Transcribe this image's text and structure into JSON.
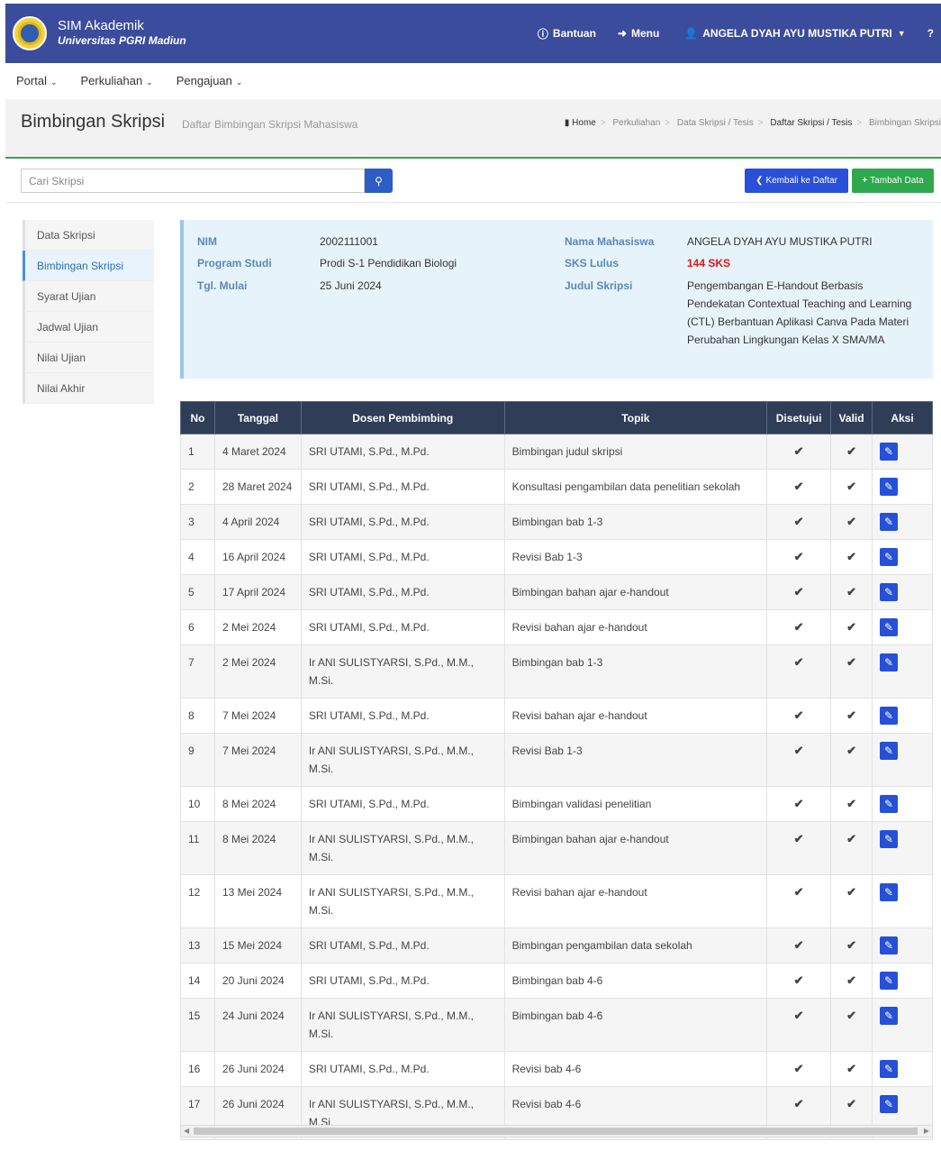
{
  "app": {
    "name": "SIM Akademik",
    "university": "Universitas PGRI Madiun"
  },
  "topnav": {
    "help": "Bantuan",
    "menu": "Menu",
    "user": "ANGELA DYAH AYU MUSTIKA PUTRI",
    "question_icon": "?"
  },
  "menubar": [
    "Portal",
    "Perkuliahan",
    "Pengajuan"
  ],
  "page": {
    "title": "Bimbingan Skripsi",
    "subtitle": "Daftar Bimbingan Skripsi Mahasiswa"
  },
  "breadcrumb": [
    "Home",
    "Perkuliahan",
    "Data Skripsi / Tesis",
    "Daftar Skripsi / Tesis",
    "Bimbingan Skripsi"
  ],
  "toolbar": {
    "search_placeholder": "Cari Skripsi",
    "back_label": "Kembali ke Daftar",
    "add_label": "Tambah Data"
  },
  "sidenav": [
    "Data Skripsi",
    "Bimbingan Skripsi",
    "Syarat Ujian",
    "Jadwal Ujian",
    "Nilai Ujian",
    "Nilai Akhir"
  ],
  "info": {
    "nim_label": "NIM",
    "nim": "2002111001",
    "prodi_label": "Program Studi",
    "prodi": "Prodi S-1 Pendidikan Biologi",
    "mulai_label": "Tgl. Mulai",
    "mulai": "25 Juni 2024",
    "nama_label": "Nama Mahasiswa",
    "nama": "ANGELA DYAH AYU MUSTIKA PUTRI",
    "sks_label": "SKS Lulus",
    "sks": "144 SKS",
    "judul_label": "Judul Skripsi",
    "judul": "Pengembangan E-Handout Berbasis Pendekatan Contextual Teaching and Learning (CTL) Berbantuan Aplikasi Canva Pada Materi Perubahan Lingkungan Kelas X SMA/MA"
  },
  "table": {
    "headers": [
      "No",
      "Tanggal",
      "Dosen Pembimbing",
      "Topik",
      "Disetujui",
      "Valid",
      "Aksi"
    ],
    "rows": [
      {
        "no": "1",
        "tanggal": "4 Maret 2024",
        "dosen": "SRI UTAMI, S.Pd., M.Pd.",
        "topik": "Bimbingan judul skripsi"
      },
      {
        "no": "2",
        "tanggal": "28 Maret 2024",
        "dosen": "SRI UTAMI, S.Pd., M.Pd.",
        "topik": "Konsultasi pengambilan data penelitian sekolah"
      },
      {
        "no": "3",
        "tanggal": "4 April 2024",
        "dosen": "SRI UTAMI, S.Pd., M.Pd.",
        "topik": "Bimbingan bab 1-3"
      },
      {
        "no": "4",
        "tanggal": "16 April 2024",
        "dosen": "SRI UTAMI, S.Pd., M.Pd.",
        "topik": "Revisi Bab 1-3"
      },
      {
        "no": "5",
        "tanggal": "17 April 2024",
        "dosen": "SRI UTAMI, S.Pd., M.Pd.",
        "topik": "Bimbingan bahan ajar e-handout"
      },
      {
        "no": "6",
        "tanggal": "2 Mei 2024",
        "dosen": "SRI UTAMI, S.Pd., M.Pd.",
        "topik": "Revisi bahan ajar e-handout"
      },
      {
        "no": "7",
        "tanggal": "2 Mei 2024",
        "dosen": "Ir ANI SULISTYARSI, S.Pd., M.M., M.Si.",
        "topik": "Bimbingan bab 1-3"
      },
      {
        "no": "8",
        "tanggal": "7 Mei 2024",
        "dosen": "SRI UTAMI, S.Pd., M.Pd.",
        "topik": "Revisi bahan ajar e-handout"
      },
      {
        "no": "9",
        "tanggal": "7 Mei 2024",
        "dosen": "Ir ANI SULISTYARSI, S.Pd., M.M., M.Si.",
        "topik": "Revisi Bab 1-3"
      },
      {
        "no": "10",
        "tanggal": "8 Mei 2024",
        "dosen": "SRI UTAMI, S.Pd., M.Pd.",
        "topik": "Bimbingan validasi penelitian"
      },
      {
        "no": "11",
        "tanggal": "8 Mei 2024",
        "dosen": "Ir ANI SULISTYARSI, S.Pd., M.M., M.Si.",
        "topik": "Bimbingan bahan ajar e-handout"
      },
      {
        "no": "12",
        "tanggal": "13 Mei 2024",
        "dosen": "Ir ANI SULISTYARSI, S.Pd., M.M., M.Si.",
        "topik": "Revisi bahan ajar e-handout"
      },
      {
        "no": "13",
        "tanggal": "15 Mei 2024",
        "dosen": "SRI UTAMI, S.Pd., M.Pd.",
        "topik": "Bimbingan pengambilan data sekolah"
      },
      {
        "no": "14",
        "tanggal": "20 Juni 2024",
        "dosen": "SRI UTAMI, S.Pd., M.Pd.",
        "topik": "Bimbingan bab 4-6"
      },
      {
        "no": "15",
        "tanggal": "24 Juni 2024",
        "dosen": "Ir ANI SULISTYARSI, S.Pd., M.M., M.Si.",
        "topik": "Bimbingan bab 4-6"
      },
      {
        "no": "16",
        "tanggal": "26 Juni 2024",
        "dosen": "SRI UTAMI, S.Pd., M.Pd.",
        "topik": "Revisi bab 4-6"
      },
      {
        "no": "17",
        "tanggal": "26 Juni 2024",
        "dosen": "Ir ANI SULISTYARSI, S.Pd., M.M., M.Si.",
        "topik": "Revisi bab 4-6"
      }
    ]
  },
  "colors": {
    "topbar": "#3a4c9b",
    "table_header": "#2f3e56",
    "check": "#2aa149",
    "edit": "#2650d8",
    "add_button": "#2ea84d",
    "back_button": "#2a4fd8"
  },
  "icons": {
    "help": "info-circle-icon",
    "menu": "sign-in-icon",
    "user": "user-icon",
    "check": "check-icon",
    "edit": "pencil-icon",
    "search": "search-icon"
  }
}
